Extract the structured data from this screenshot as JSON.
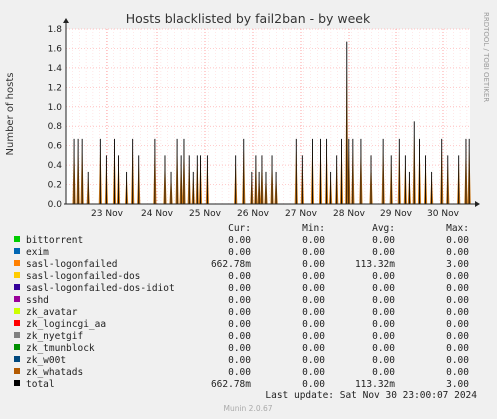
{
  "chart_data": {
    "type": "area",
    "title": "Hosts blacklisted by fail2ban - by week",
    "ylabel": "Number of hosts",
    "side_label": "RRDTOOL / TOBI OETIKER",
    "ylim": [
      0,
      1.8
    ],
    "y_ticks": [
      "0.0",
      "0.2",
      "0.4",
      "0.6",
      "0.8",
      "1.0",
      "1.2",
      "1.4",
      "1.6",
      "1.8"
    ],
    "x_ticks": [
      "23 Nov",
      "24 Nov",
      "25 Nov",
      "26 Nov",
      "27 Nov",
      "28 Nov",
      "29 Nov",
      "30 Nov"
    ],
    "grid": true,
    "series_fill": "#cc7a1a",
    "series_line": "#000000",
    "spikes": [
      {
        "x": 0.2,
        "y": 0.67
      },
      {
        "x": 0.3,
        "y": 0.67
      },
      {
        "x": 0.4,
        "y": 0.67
      },
      {
        "x": 0.55,
        "y": 0.33
      },
      {
        "x": 0.85,
        "y": 0.67
      },
      {
        "x": 1.0,
        "y": 0.5
      },
      {
        "x": 1.2,
        "y": 0.67
      },
      {
        "x": 1.3,
        "y": 0.5
      },
      {
        "x": 1.5,
        "y": 0.33
      },
      {
        "x": 1.65,
        "y": 0.67
      },
      {
        "x": 1.8,
        "y": 0.5
      },
      {
        "x": 2.2,
        "y": 0.67
      },
      {
        "x": 2.45,
        "y": 0.5
      },
      {
        "x": 2.6,
        "y": 0.33
      },
      {
        "x": 2.75,
        "y": 0.67
      },
      {
        "x": 2.85,
        "y": 0.5
      },
      {
        "x": 2.92,
        "y": 0.67
      },
      {
        "x": 3.05,
        "y": 0.5
      },
      {
        "x": 3.15,
        "y": 0.33
      },
      {
        "x": 3.25,
        "y": 0.5
      },
      {
        "x": 3.33,
        "y": 0.5
      },
      {
        "x": 3.5,
        "y": 0.5
      },
      {
        "x": 4.2,
        "y": 0.5
      },
      {
        "x": 4.4,
        "y": 0.67
      },
      {
        "x": 4.6,
        "y": 0.33
      },
      {
        "x": 4.7,
        "y": 0.5
      },
      {
        "x": 4.78,
        "y": 0.33
      },
      {
        "x": 4.85,
        "y": 0.5
      },
      {
        "x": 4.95,
        "y": 0.33
      },
      {
        "x": 5.1,
        "y": 0.5
      },
      {
        "x": 5.2,
        "y": 0.33
      },
      {
        "x": 5.7,
        "y": 0.67
      },
      {
        "x": 5.85,
        "y": 0.5
      },
      {
        "x": 6.1,
        "y": 0.67
      },
      {
        "x": 6.3,
        "y": 0.67
      },
      {
        "x": 6.45,
        "y": 0.67
      },
      {
        "x": 6.55,
        "y": 0.33
      },
      {
        "x": 6.7,
        "y": 0.5
      },
      {
        "x": 6.82,
        "y": 0.67
      },
      {
        "x": 6.95,
        "y": 1.67
      },
      {
        "x": 7.0,
        "y": 0.67
      },
      {
        "x": 7.1,
        "y": 0.67
      },
      {
        "x": 7.3,
        "y": 0.67
      },
      {
        "x": 7.55,
        "y": 0.5
      },
      {
        "x": 7.85,
        "y": 0.67
      },
      {
        "x": 8.05,
        "y": 0.5
      },
      {
        "x": 8.25,
        "y": 0.67
      },
      {
        "x": 8.4,
        "y": 0.5
      },
      {
        "x": 8.5,
        "y": 0.33
      },
      {
        "x": 8.62,
        "y": 0.85
      },
      {
        "x": 8.75,
        "y": 0.67
      },
      {
        "x": 8.9,
        "y": 0.5
      },
      {
        "x": 9.05,
        "y": 0.33
      },
      {
        "x": 9.3,
        "y": 0.67
      },
      {
        "x": 9.45,
        "y": 0.5
      },
      {
        "x": 9.72,
        "y": 0.5
      },
      {
        "x": 9.9,
        "y": 0.67
      },
      {
        "x": 9.98,
        "y": 0.67
      }
    ]
  },
  "legend": {
    "headers": {
      "cur": "Cur:",
      "min": "Min:",
      "avg": "Avg:",
      "max": "Max:"
    },
    "rows": [
      {
        "name": "bittorrent",
        "color": "#00cc00",
        "cur": "0.00",
        "min": "0.00",
        "avg": "0.00",
        "max": "0.00"
      },
      {
        "name": "exim",
        "color": "#0066b3",
        "cur": "0.00",
        "min": "0.00",
        "avg": "0.00",
        "max": "0.00"
      },
      {
        "name": "sasl-logonfailed",
        "color": "#ff8000",
        "cur": "662.78m",
        "min": "0.00",
        "avg": "113.32m",
        "max": "3.00"
      },
      {
        "name": "sasl-logonfailed-dos",
        "color": "#ffcc00",
        "cur": "0.00",
        "min": "0.00",
        "avg": "0.00",
        "max": "0.00"
      },
      {
        "name": "sasl-logonfailed-dos-idiot",
        "color": "#330099",
        "cur": "0.00",
        "min": "0.00",
        "avg": "0.00",
        "max": "0.00"
      },
      {
        "name": "sshd",
        "color": "#990099",
        "cur": "0.00",
        "min": "0.00",
        "avg": "0.00",
        "max": "0.00"
      },
      {
        "name": "zk_avatar",
        "color": "#ccff00",
        "cur": "0.00",
        "min": "0.00",
        "avg": "0.00",
        "max": "0.00"
      },
      {
        "name": "zk_logincgi_aa",
        "color": "#ff0000",
        "cur": "0.00",
        "min": "0.00",
        "avg": "0.00",
        "max": "0.00"
      },
      {
        "name": "zk_nyetgif",
        "color": "#808080",
        "cur": "0.00",
        "min": "0.00",
        "avg": "0.00",
        "max": "0.00"
      },
      {
        "name": "zk_tmunblock",
        "color": "#008f00",
        "cur": "0.00",
        "min": "0.00",
        "avg": "0.00",
        "max": "0.00"
      },
      {
        "name": "zk_w00t",
        "color": "#00487d",
        "cur": "0.00",
        "min": "0.00",
        "avg": "0.00",
        "max": "0.00"
      },
      {
        "name": "zk_whatads",
        "color": "#b35a00",
        "cur": "0.00",
        "min": "0.00",
        "avg": "0.00",
        "max": "0.00"
      },
      {
        "name": "total",
        "color": "#000000",
        "cur": "662.78m",
        "min": "0.00",
        "avg": "113.32m",
        "max": "3.00"
      }
    ]
  },
  "last_update": "Last update: Sat Nov 30 23:00:07 2024",
  "footer": "Munin 2.0.67"
}
